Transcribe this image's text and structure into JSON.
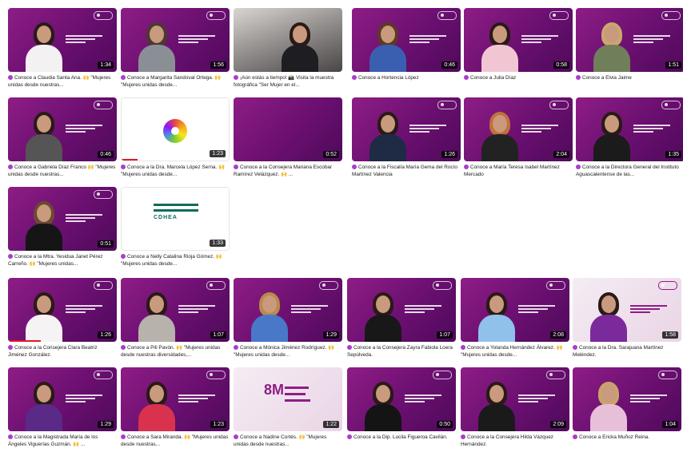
{
  "videos": [
    {
      "title": "Conoce a Claudia Santa Ana. 🙌 \"Mujeres unidas desde nuestras...",
      "duration": "1:34",
      "style": "purple",
      "progress": 0
    },
    {
      "title": "Conoce a Margarita Sandoval Ortega. 🙌 \"Mujeres unidas desde...",
      "duration": "1:56",
      "style": "purple",
      "progress": 0
    },
    {
      "title": "¡Aún estás a tiempo! 📸 Visita la muestra fotográfica \"Ser Mujer en el...",
      "duration": "",
      "style": "photo",
      "progress": 0
    },
    {
      "title": "Conoce a Hortencia López",
      "duration": "0:46",
      "style": "purple",
      "progress": 0
    },
    {
      "title": "Conoce a Julia Díaz",
      "duration": "0:58",
      "style": "purple",
      "progress": 0
    },
    {
      "title": "Conoce a Elvia Jaime",
      "duration": "1:51",
      "style": "purple",
      "progress": 0
    },
    {
      "title": "Conoce a Gabriela Díaz Franco 🙌 \"Mujeres unidas desde nuestras...",
      "duration": "0:46",
      "style": "purple",
      "progress": 0
    },
    {
      "title": "Conoce a la Dra. Marcela López Serna. 🙌 \"Mujeres unidas desde...",
      "duration": "1:23",
      "style": "flower",
      "progress": 0.15
    },
    {
      "title": "Conoce a la Consejera Mariana Escobar Ramírez Velázquez. 🙌 ...",
      "duration": "0:52",
      "style": "purple",
      "progress": 0
    },
    {
      "title": "Conoce a la Fiscalía María Gema del Rocío Martínez Valencia",
      "duration": "1:26",
      "style": "purple",
      "progress": 0
    },
    {
      "title": "Conoce a María Teresa Isabel Martínez Mercado",
      "duration": "2:04",
      "style": "purple",
      "progress": 0
    },
    {
      "title": "Conoce a la Directora General del Instituto Aguascalentense de las...",
      "duration": "1:35",
      "style": "purple",
      "progress": 0
    },
    {
      "title": "Conoce a la Mtra. Yesidua Janet Pérez Carreño. 🙌 \"Mujeres unidas...",
      "duration": "0:51",
      "style": "purple",
      "progress": 0
    },
    {
      "title": "Conoce a Nelly Catalina Rioja Gómez. 🙌 \"Mujeres unidas desde...",
      "duration": "1:33",
      "style": "bars",
      "progress": 0
    },
    {
      "title": "Conoce a la Consejera Clara Beatriz Jiménez González.",
      "duration": "1:26",
      "style": "purple",
      "progress": 0.3
    },
    {
      "title": "Conoce a Pili Pavón. 🙌 \"Mujeres unidas desde nuestras diversidades,...",
      "duration": "1:07",
      "style": "purple",
      "progress": 0
    },
    {
      "title": "Conoce a Mónica Jiménez Rodríguez. 🙌 \"Mujeres unidas desde...",
      "duration": "1:29",
      "style": "purple",
      "progress": 0
    },
    {
      "title": "Conoce a la Consejera Zayra Fabiola Loera Sepúlveda.",
      "duration": "1:07",
      "style": "purple",
      "progress": 0
    },
    {
      "title": "Conoce a Yolanda Hernández Álvarez. 🙌 \"Mujeres unidas desde...",
      "duration": "2:08",
      "style": "purple",
      "progress": 0
    },
    {
      "title": "Conoce a la Dra. Sarajuana Martínez Meléndez.",
      "duration": "1:58",
      "style": "light",
      "progress": 0
    },
    {
      "title": "Conoce a la Magistrada María de los Ángeles Viguerías Guzmán. 🙌 ...",
      "duration": "1:29",
      "style": "purple",
      "progress": 0
    },
    {
      "title": "Conoce a Sara Miranda. 🙌 \"Mujeres unidas desde nuestras...",
      "duration": "1:23",
      "style": "purple",
      "progress": 0
    },
    {
      "title": "Conoce a Nadine Cortés. 🙌 \"Mujeres unidas desde nuestras...",
      "duration": "1:22",
      "style": "poster",
      "progress": 0
    },
    {
      "title": "Conoce a la Dip. Lucila Figueroa Cavilán.",
      "duration": "0:50",
      "style": "purple",
      "progress": 0
    },
    {
      "title": "Conoce a la Consejera Hilda Vázquez Hernández.",
      "duration": "2:09",
      "style": "purple",
      "progress": 0
    },
    {
      "title": "Conoce a Ericka Muñoz Reina.",
      "duration": "1:04",
      "style": "purple",
      "progress": 0
    }
  ],
  "colors": {
    "accent": "#8e1d86",
    "progress": "#e0162b",
    "heart": "#a740c9"
  }
}
